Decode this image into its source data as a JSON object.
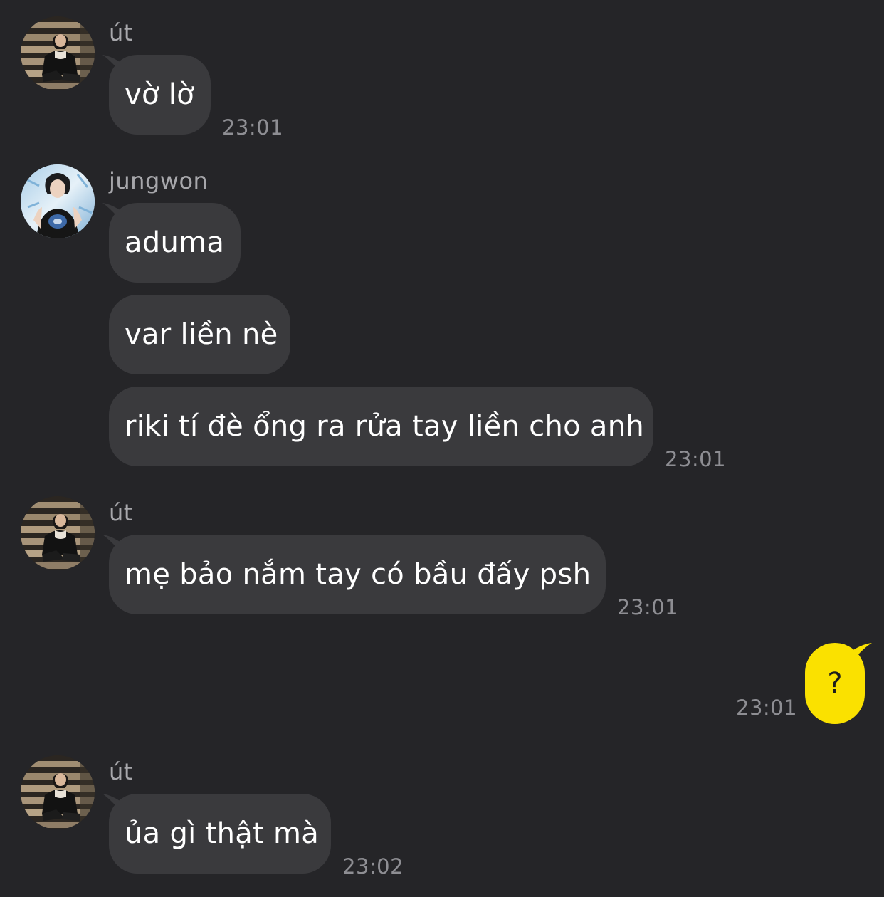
{
  "colors": {
    "background": "#252528",
    "bubble_received": "#3a3a3d",
    "bubble_sent": "#fae100",
    "sender_text": "#a7a7ab",
    "timestamp_text": "#8e8e93"
  },
  "messages": [
    {
      "sender": "út",
      "avatar": "stairs-portrait-avatar",
      "bubbles": [
        "vờ lờ"
      ],
      "time": "23:01"
    },
    {
      "sender": "jungwon",
      "avatar": "blue-portrait-avatar",
      "bubbles": [
        "aduma",
        "var liền nè",
        "riki tí đè ổng ra rửa tay liền cho anh"
      ],
      "time": "23:01"
    },
    {
      "sender": "út",
      "avatar": "stairs-portrait-avatar",
      "bubbles": [
        "mẹ bảo nắm tay có bầu đấy psh"
      ],
      "time": "23:01"
    },
    {
      "sender": "me",
      "bubbles": [
        "?"
      ],
      "time": "23:01"
    },
    {
      "sender": "út",
      "avatar": "stairs-portrait-avatar",
      "bubbles": [
        "ủa gì thật mà"
      ],
      "time": "23:02"
    }
  ]
}
